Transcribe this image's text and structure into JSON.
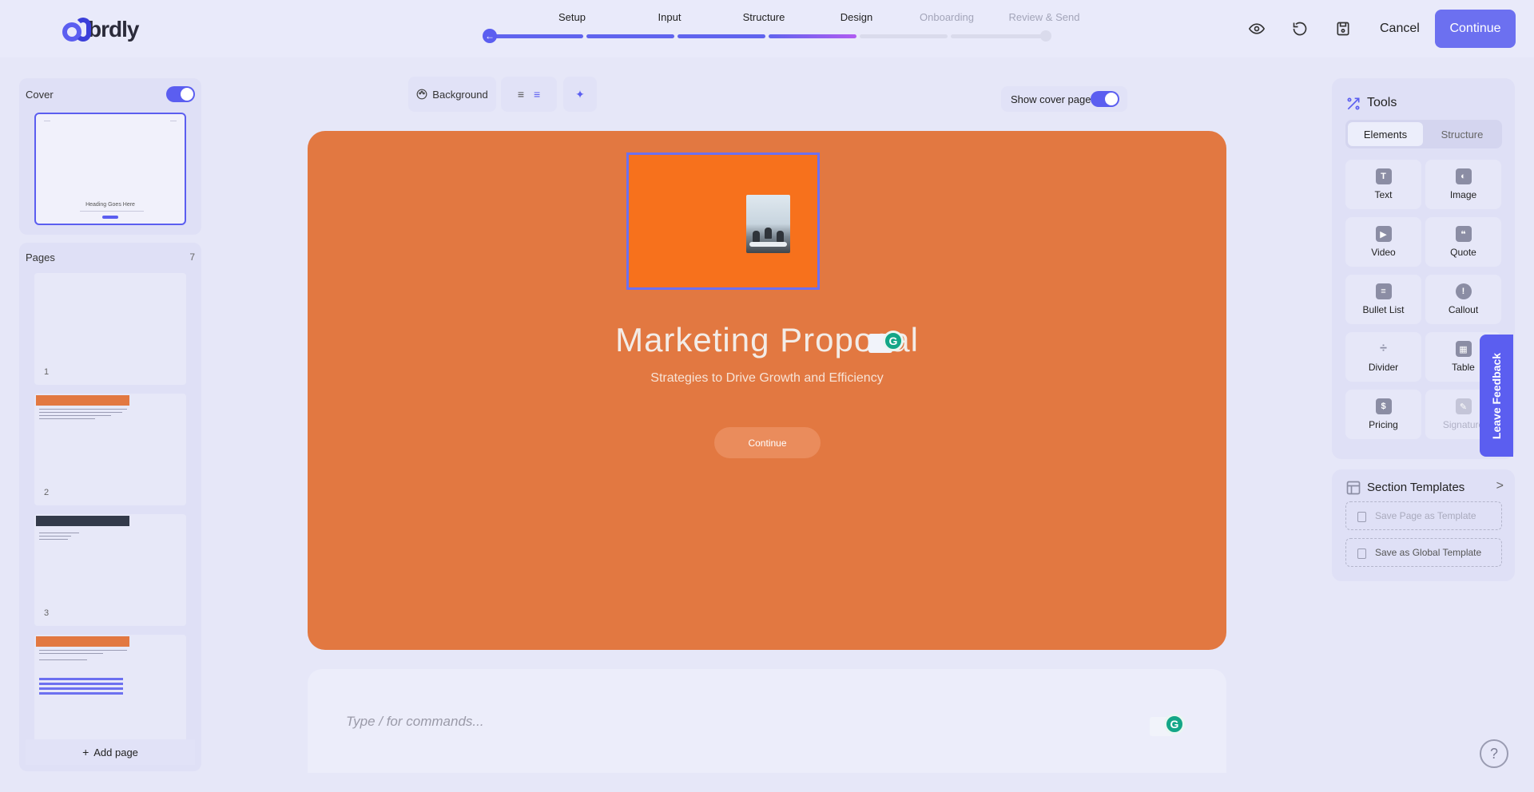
{
  "app": {
    "logo_text": "brdly"
  },
  "steps": [
    {
      "label": "Setup",
      "state": "done"
    },
    {
      "label": "Input",
      "state": "done"
    },
    {
      "label": "Structure",
      "state": "done"
    },
    {
      "label": "Design",
      "state": "current"
    },
    {
      "label": "Onboarding",
      "state": "todo"
    },
    {
      "label": "Review & Send",
      "state": "todo"
    }
  ],
  "header": {
    "cancel_label": "Cancel",
    "continue_label": "Continue",
    "icons": [
      "eye-icon",
      "undo-icon",
      "save-icon"
    ]
  },
  "sidebar": {
    "cover_label": "Cover",
    "cover_enabled": true,
    "cover_thumb_heading": "Heading Goes Here",
    "pages_label": "Pages",
    "pages_count": "7",
    "page_numbers": [
      "1",
      "2",
      "3"
    ],
    "add_page_label": "Add page"
  },
  "toolbar": {
    "background_label": "Background",
    "show_cover_label": "Show cover page",
    "show_cover_enabled": true
  },
  "canvas": {
    "title": "Marketing Proposal",
    "subtitle": "Strategies to Drive Growth and Efficiency",
    "button_label": "Continue",
    "background_color": "#e27841",
    "image_bg_color": "#f7711c"
  },
  "command": {
    "placeholder": "Type / for commands..."
  },
  "tools": {
    "title": "Tools",
    "tabs": [
      "Elements",
      "Structure"
    ],
    "items": [
      {
        "label": "Text",
        "icon": "text-icon",
        "glyph": "T"
      },
      {
        "label": "Image",
        "icon": "image-icon",
        "glyph": "◐"
      },
      {
        "label": "Video",
        "icon": "video-icon",
        "glyph": "▶"
      },
      {
        "label": "Quote",
        "icon": "quote-icon",
        "glyph": "❝"
      },
      {
        "label": "Bullet List",
        "icon": "bullet-list-icon",
        "glyph": "≡"
      },
      {
        "label": "Callout",
        "icon": "callout-icon",
        "glyph": "!"
      },
      {
        "label": "Divider",
        "icon": "divider-icon",
        "glyph": "÷"
      },
      {
        "label": "Table",
        "icon": "table-icon",
        "glyph": "▦"
      },
      {
        "label": "Pricing",
        "icon": "pricing-icon",
        "glyph": "$"
      },
      {
        "label": "Signature",
        "icon": "signature-icon",
        "glyph": "✎"
      }
    ]
  },
  "templates": {
    "title": "Section Templates",
    "save_page_label": "Save Page as Template",
    "save_global_label": "Save as Global Template"
  },
  "feedback_label": "Leave Feedback",
  "help_glyph": "?",
  "colors": {
    "accent": "#5b5ef0",
    "canvas": "#e27841"
  }
}
